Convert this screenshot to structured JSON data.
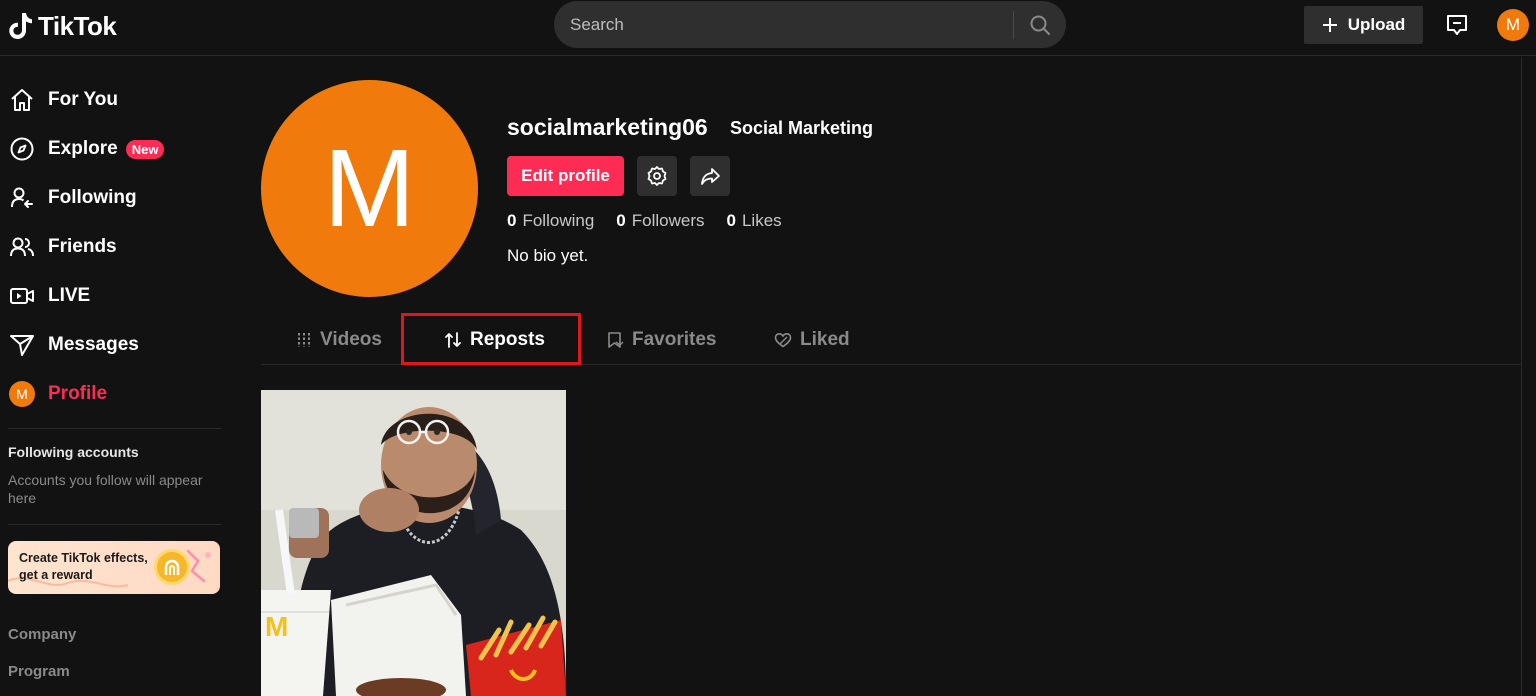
{
  "header": {
    "logo_text": "TikTok",
    "search_placeholder": "Search",
    "upload_label": "Upload",
    "avatar_letter": "M"
  },
  "sidebar": {
    "items": [
      {
        "label": "For You",
        "icon": "home-icon"
      },
      {
        "label": "Explore",
        "icon": "compass-icon",
        "badge": "New"
      },
      {
        "label": "Following",
        "icon": "following-icon"
      },
      {
        "label": "Friends",
        "icon": "friends-icon"
      },
      {
        "label": "LIVE",
        "icon": "live-icon"
      },
      {
        "label": "Messages",
        "icon": "messages-icon"
      },
      {
        "label": "Profile",
        "icon": "profile-avatar",
        "avatar_letter": "M",
        "active": true
      }
    ],
    "following_title": "Following accounts",
    "following_desc": "Accounts you follow will appear here",
    "effects_text": "Create TikTok effects, get a reward",
    "links": [
      "Company",
      "Program"
    ]
  },
  "profile": {
    "avatar_letter": "M",
    "username": "socialmarketing06",
    "display_name": "Social Marketing",
    "edit_label": "Edit profile",
    "stats": [
      {
        "num": "0",
        "label": "Following"
      },
      {
        "num": "0",
        "label": "Followers"
      },
      {
        "num": "0",
        "label": "Likes"
      }
    ],
    "bio": "No bio yet."
  },
  "tabs": [
    {
      "label": "Videos",
      "icon": "grid-icon"
    },
    {
      "label": "Reposts",
      "icon": "repost-icon",
      "active": true
    },
    {
      "label": "Favorites",
      "icon": "bookmark-icon"
    },
    {
      "label": "Liked",
      "icon": "heart-icon"
    }
  ],
  "colors": {
    "accent": "#fe2c55",
    "avatar": "#f07a0c",
    "background": "#121212",
    "highlight": "#e0161c"
  }
}
